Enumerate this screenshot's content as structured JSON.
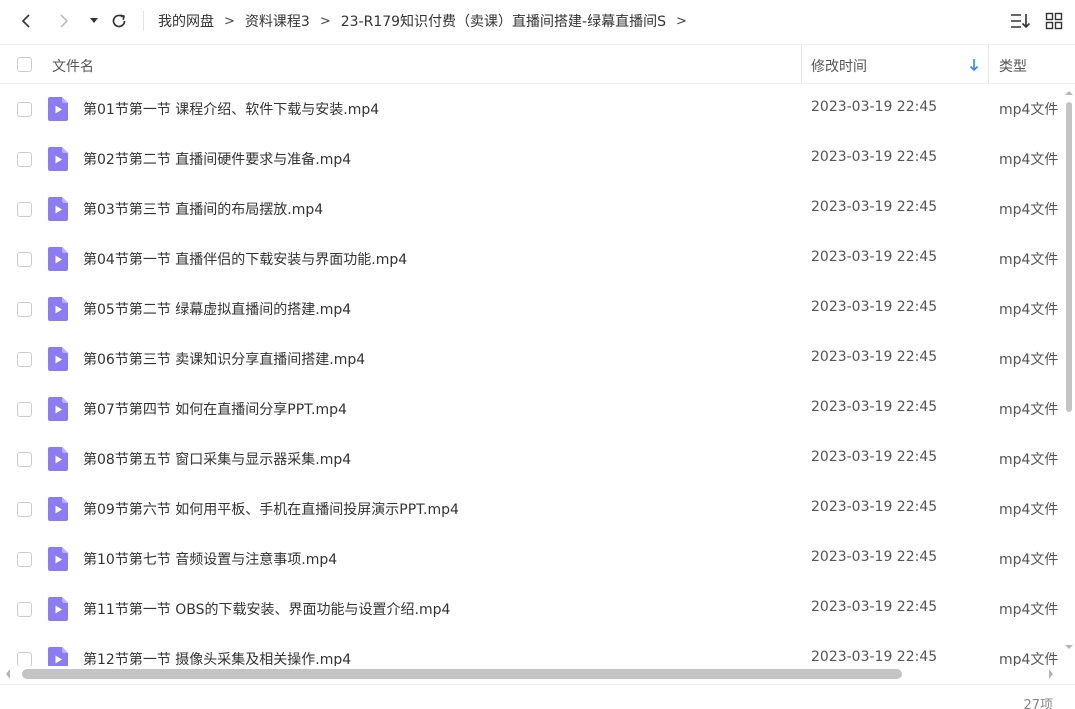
{
  "toolbar": {
    "back_icon": "chevron-left-icon",
    "forward_icon": "chevron-right-icon",
    "history_icon": "caret-down-icon",
    "refresh_icon": "refresh-icon",
    "sort_view_icon": "sort-list-icon",
    "grid_view_icon": "grid-icon"
  },
  "breadcrumb": {
    "items": [
      "我的网盘",
      "资料课程3",
      "23-R179知识付费（卖课）直播间搭建-绿幕直播间S"
    ],
    "separator": ">"
  },
  "header": {
    "name": "文件名",
    "modified": "修改时间",
    "type": "类型",
    "sort_direction": "descending"
  },
  "files": [
    {
      "name": "第01节第一节 课程介绍、软件下载与安装.mp4",
      "time": "2023-03-19 22:45",
      "type": "mp4文件"
    },
    {
      "name": "第02节第二节 直播间硬件要求与准备.mp4",
      "time": "2023-03-19 22:45",
      "type": "mp4文件"
    },
    {
      "name": "第03节第三节 直播间的布局摆放.mp4",
      "time": "2023-03-19 22:45",
      "type": "mp4文件"
    },
    {
      "name": "第04节第一节 直播伴侣的下载安装与界面功能.mp4",
      "time": "2023-03-19 22:45",
      "type": "mp4文件"
    },
    {
      "name": "第05节第二节 绿幕虚拟直播间的搭建.mp4",
      "time": "2023-03-19 22:45",
      "type": "mp4文件"
    },
    {
      "name": "第06节第三节 卖课知识分享直播间搭建.mp4",
      "time": "2023-03-19 22:45",
      "type": "mp4文件"
    },
    {
      "name": "第07节第四节 如何在直播间分享PPT.mp4",
      "time": "2023-03-19 22:45",
      "type": "mp4文件"
    },
    {
      "name": "第08节第五节 窗口采集与显示器采集.mp4",
      "time": "2023-03-19 22:45",
      "type": "mp4文件"
    },
    {
      "name": "第09节第六节 如何用平板、手机在直播间投屏演示PPT.mp4",
      "time": "2023-03-19 22:45",
      "type": "mp4文件"
    },
    {
      "name": "第10节第七节 音频设置与注意事项.mp4",
      "time": "2023-03-19 22:45",
      "type": "mp4文件"
    },
    {
      "name": "第11节第一节 OBS的下载安装、界面功能与设置介绍.mp4",
      "time": "2023-03-19 22:45",
      "type": "mp4文件"
    },
    {
      "name": "第12节第一节 摄像头采集及相关操作.mp4",
      "time": "2023-03-19 22:45",
      "type": "mp4文件"
    }
  ],
  "footer": {
    "count": "27项"
  },
  "colors": {
    "file_icon": "#8b7cf6",
    "sort_arrow": "#2f88ff",
    "scroll_thumb": "#c4c4c4"
  }
}
